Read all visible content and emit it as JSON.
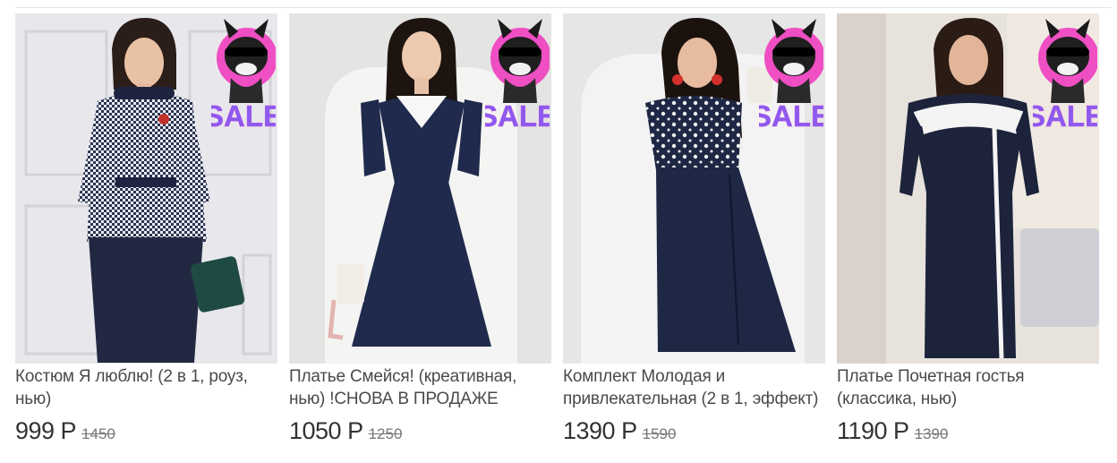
{
  "badge": {
    "text": "SALE",
    "icon": "bulldog-sunglasses-sale-sticker"
  },
  "products": [
    {
      "title": "Костюм Я люблю! (2 в 1, роуз, нью)",
      "price": "999 Р",
      "old_price": "1450",
      "image": "woman-in-houndstooth-peplum-suit"
    },
    {
      "title": "Платье Смейся! (креативная, нью) !СНОВА В ПРОДАЖЕ",
      "price": "1050 Р",
      "old_price": "1250",
      "image": "woman-in-navy-dress-white-collar"
    },
    {
      "title": "Комплект Молодая и привлекательная (2 в 1, эффект)",
      "price": "1390 Р",
      "old_price": "1590",
      "image": "woman-in-polka-dot-top-navy-skirt"
    },
    {
      "title": "Платье Почетная гостья (классика, нью)",
      "price": "1190 Р",
      "old_price": "1390",
      "image": "woman-in-navy-dress-white-stripes"
    }
  ]
}
